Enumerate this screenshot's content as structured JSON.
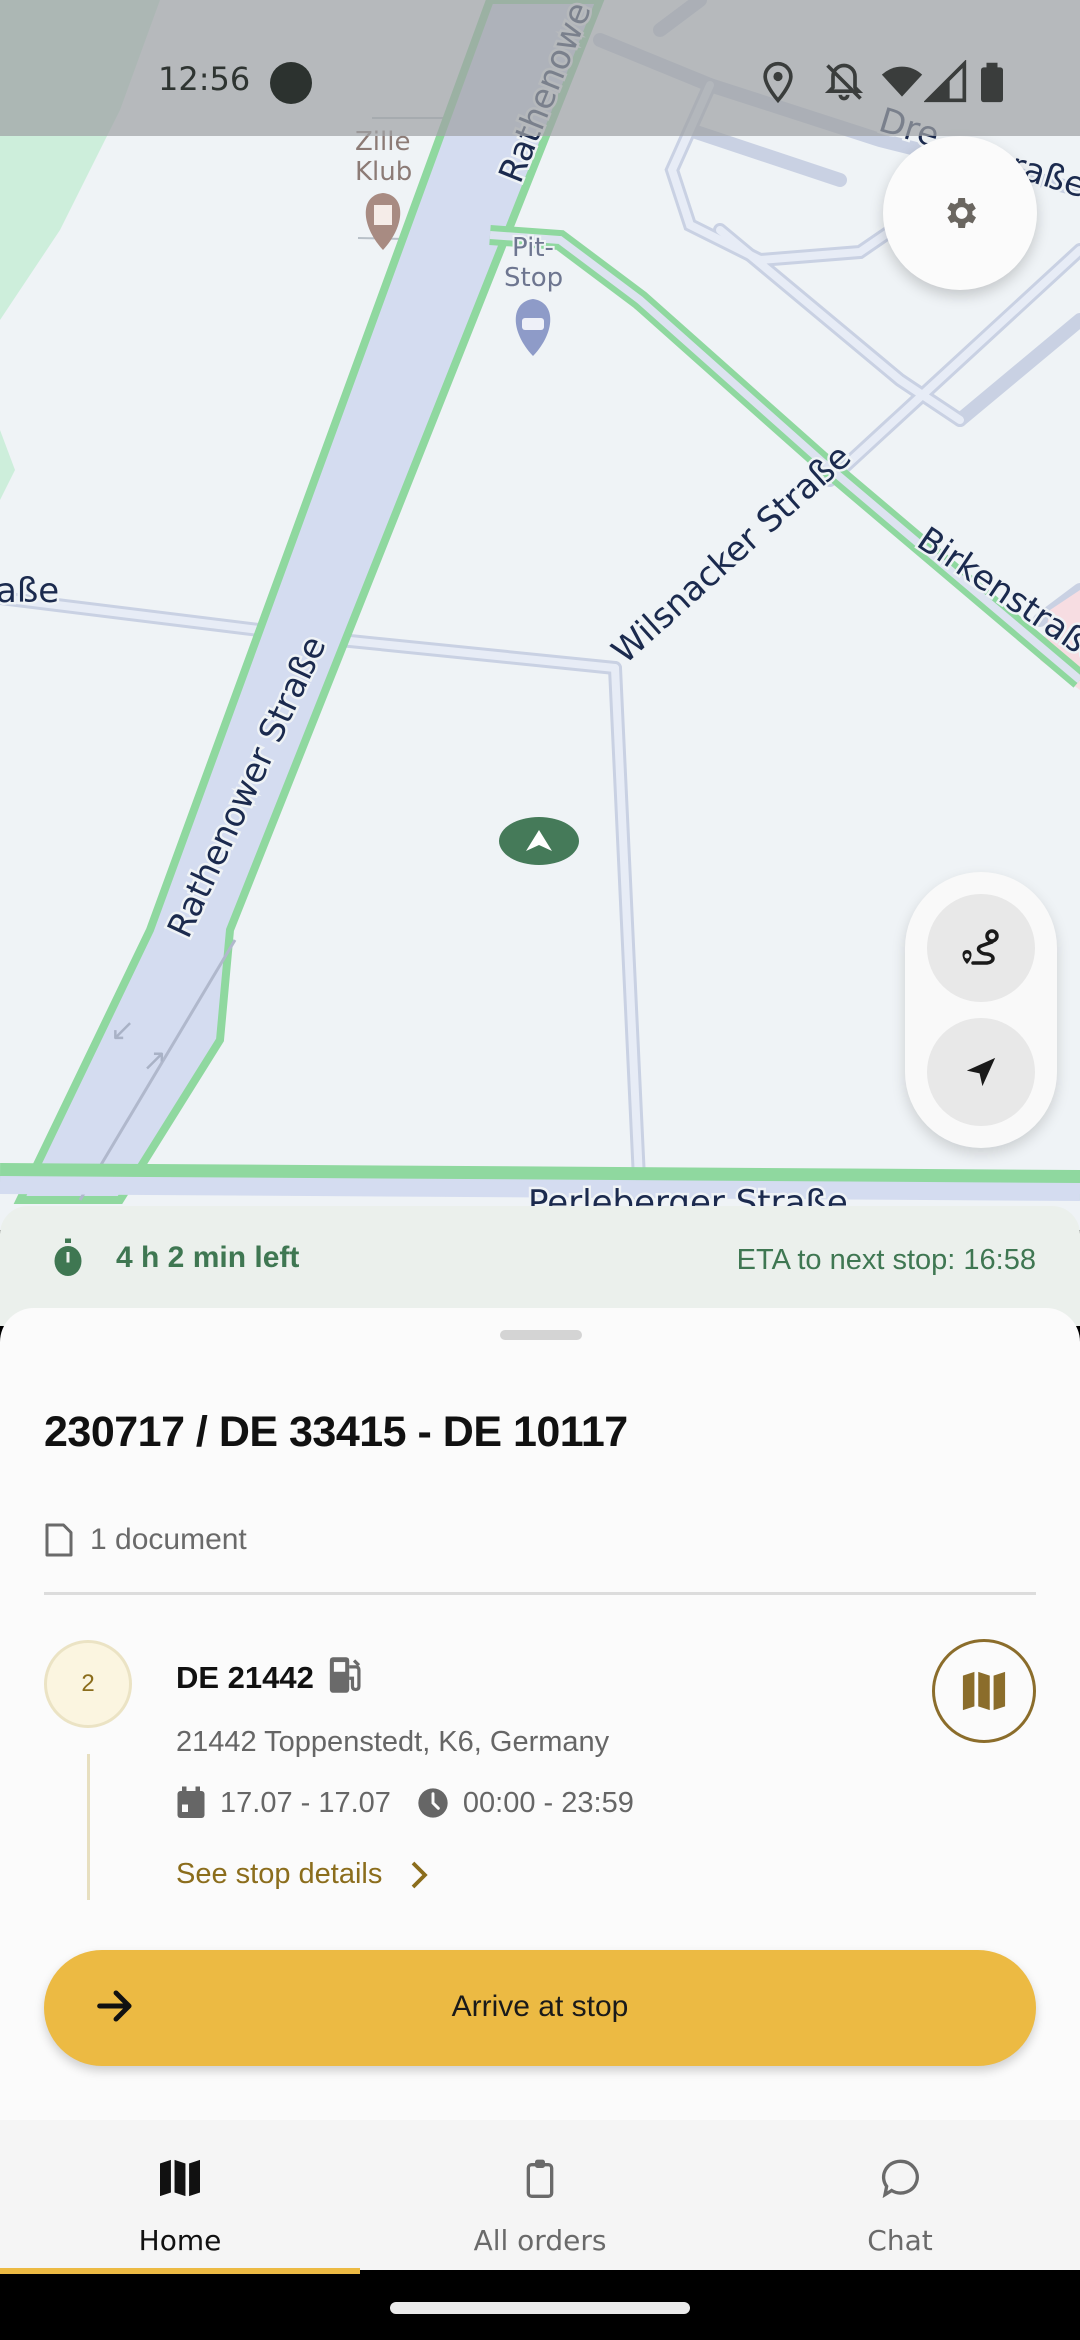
{
  "status_bar": {
    "time": "12:56",
    "icons": [
      "location-icon",
      "notifications-off-icon",
      "wifi-icon",
      "cell-signal-icon",
      "battery-icon"
    ]
  },
  "map": {
    "street_labels": {
      "rathenower_top": "Rathenowe",
      "rathenower_main": "Rathenower Straße",
      "wilsnacker": "Wilsnacker Straße",
      "birken": "Birkenstraße",
      "dreirosen_start": "Dre",
      "dreirosen_end": "raße",
      "left_partial": "aße",
      "perleberger": "Perleberger Straße"
    },
    "pois": [
      {
        "name": "Zille Klub",
        "line1": "Zille",
        "line2": "Klub",
        "icon": "building-icon",
        "color": "#a88b82"
      },
      {
        "name": "Pit-Stop",
        "line1": "Pit-",
        "line2": "Stop",
        "icon": "car-repair-icon",
        "color": "#8e9bc8"
      }
    ],
    "colors": {
      "road_fill": "#d4dcf0",
      "route_green": "#8fd89f",
      "park_green": "#cdeedb",
      "marker_green": "#457a59"
    }
  },
  "controls": {
    "settings_icon": "gear-icon",
    "route_overview_icon": "route-icon",
    "recenter_icon": "navigation-arrow-icon"
  },
  "eta": {
    "time_left": "4 h 2 min left",
    "eta_next_stop": "ETA to next stop: 16:58"
  },
  "order": {
    "title": "230717 / DE 33415 - DE 10117",
    "documents_label": "1 document"
  },
  "stop": {
    "number": "2",
    "name": "DE 21442",
    "type_icon": "fuel-pump-icon",
    "address": "21442 Toppenstedt, K6, Germany",
    "date_range": "17.07 - 17.07",
    "time_range": "00:00 - 23:59",
    "details_link": "See stop details"
  },
  "actions": {
    "arrive_label": "Arrive at stop"
  },
  "bottom_nav": {
    "items": [
      {
        "label": "Home",
        "icon": "map-icon",
        "active": true
      },
      {
        "label": "All orders",
        "icon": "clipboard-icon",
        "active": false
      },
      {
        "label": "Chat",
        "icon": "chat-bubble-icon",
        "active": false
      }
    ]
  },
  "theme": {
    "accent_yellow": "#ecba43",
    "accent_brown": "#8b6d2b",
    "eta_green": "#3f7752"
  }
}
